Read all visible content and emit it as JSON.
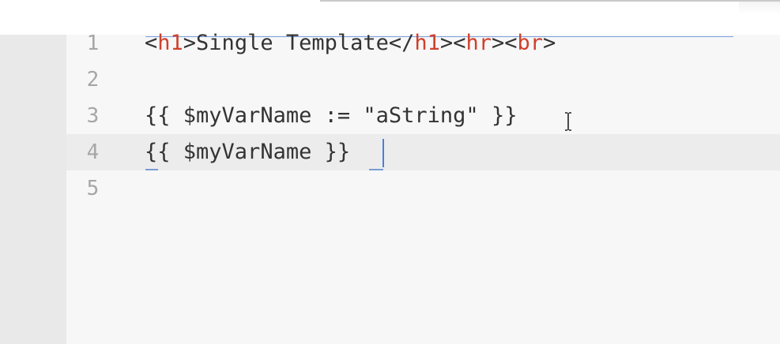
{
  "editor": {
    "line_numbers": [
      "1",
      "2",
      "3",
      "4",
      "5"
    ],
    "lines": {
      "l1": {
        "open_h1_lt": "<",
        "open_h1_name": "h1",
        "open_h1_gt": ">",
        "text": "Single Template",
        "close_h1_lt": "</",
        "close_h1_name": "h1",
        "close_h1_gt": ">",
        "hr_lt": "<",
        "hr_name": "hr",
        "hr_gt": ">",
        "br_lt": "<",
        "br_name": "br",
        "br_gt": ">"
      },
      "l3": {
        "open": "{{ ",
        "var": "$myVarName",
        "op": " := ",
        "str": "\"aString\"",
        "close": " }}"
      },
      "l4": {
        "open": "{{ ",
        "var": "$myVarName",
        "close": " }}"
      }
    },
    "colors": {
      "gutter_bg": "#e9e9e9",
      "editor_bg": "#f7f7f7",
      "current_line_bg": "#ececec",
      "tag_name": "#d0402b",
      "text": "#333333",
      "line_number": "#a6a6a6",
      "caret": "#4a7fe0"
    }
  }
}
